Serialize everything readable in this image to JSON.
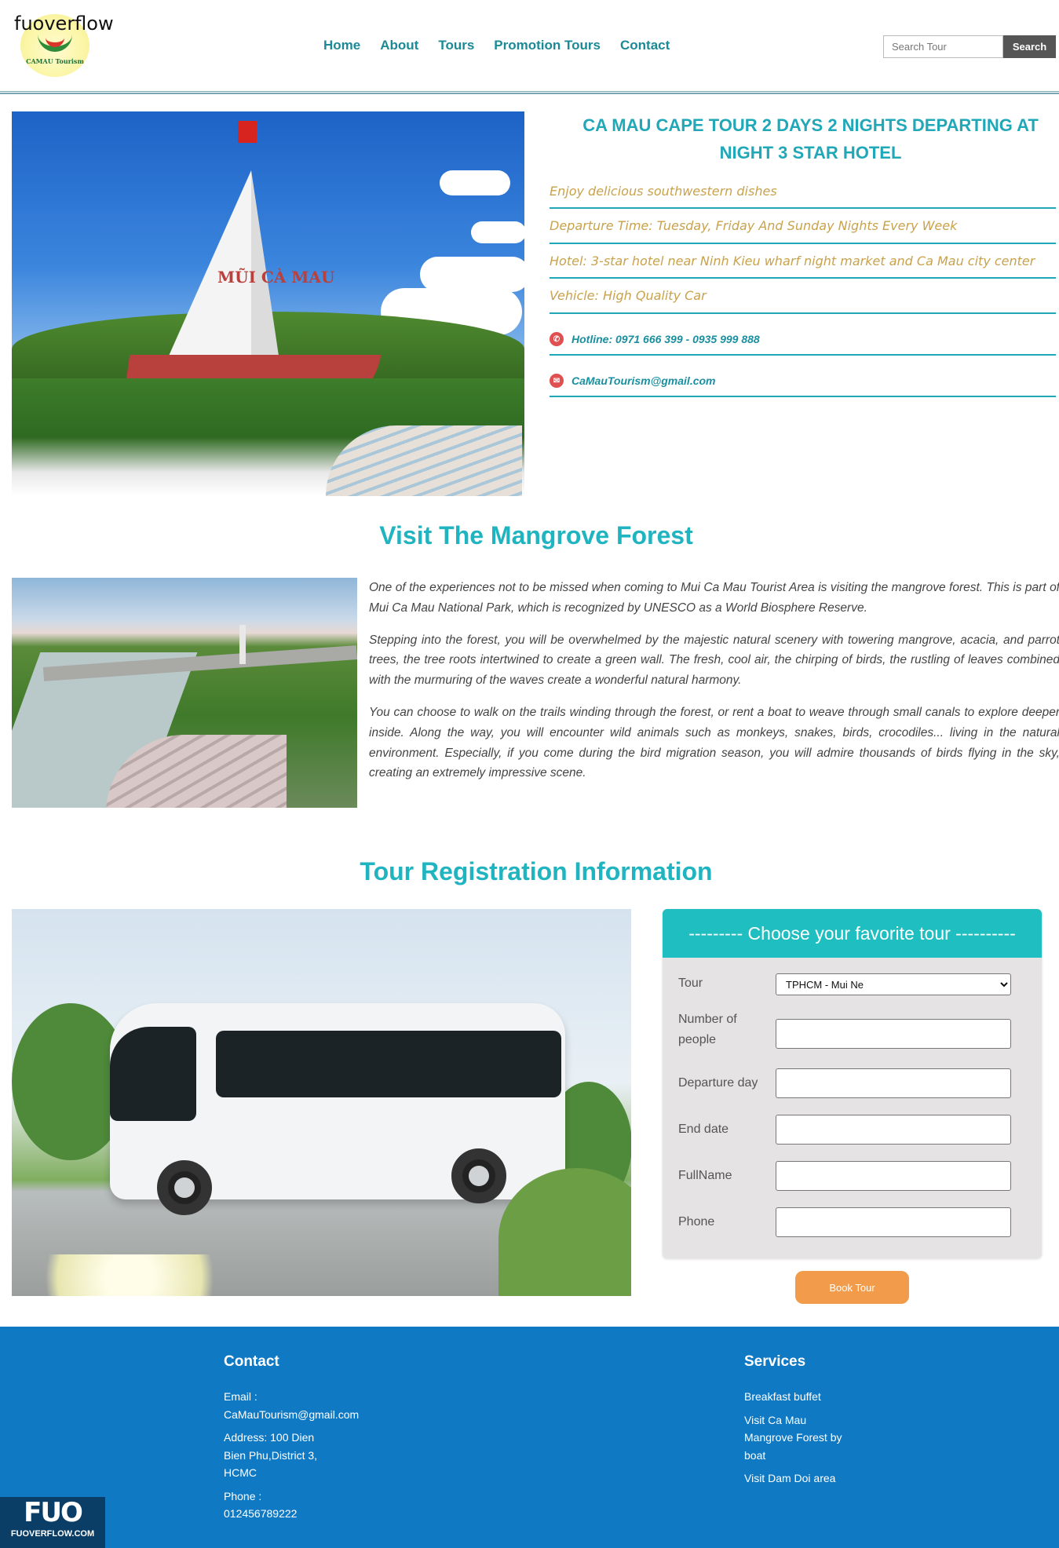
{
  "header": {
    "watermark": "fuoverflow",
    "logo_text": "CAMAU Tourism",
    "nav": [
      "Home",
      "About",
      "Tours",
      "Promotion Tours",
      "Contact"
    ],
    "search_placeholder": "Search Tour",
    "search_button": "Search"
  },
  "hero": {
    "title": "CA MAU CAPE TOUR 2 DAYS 2 NIGHTS DEPARTING AT NIGHT 3 STAR HOTEL",
    "image_sign": "MŨI CÀ MAU",
    "items": [
      "Enjoy delicious southwestern dishes",
      "Departure Time: Tuesday, Friday And Sunday Nights Every Week",
      "Hotel: 3-star hotel near Ninh Kieu wharf night market and Ca Mau city center",
      "Vehicle: High Quality Car"
    ],
    "hotline": "Hotline: 0971 666 399 - 0935 999 888",
    "email": "CaMauTourism@gmail.com"
  },
  "mangrove": {
    "title": "Visit The Mangrove Forest",
    "paragraphs": [
      "One of the experiences not to be missed when coming to Mui Ca Mau Tourist Area is visiting the mangrove forest. This is part of Mui Ca Mau National Park, which is recognized by UNESCO as a World Biosphere Reserve.",
      "Stepping into the forest, you will be overwhelmed by the majestic natural scenery with towering mangrove, acacia, and parrot trees, the tree roots intertwined to create a green wall. The fresh, cool air, the chirping of birds, the rustling of leaves combined with the murmuring of the waves create a wonderful natural harmony.",
      "You can choose to walk on the trails winding through the forest, or rent a boat to weave through small canals to explore deeper inside. Along the way, you will encounter wild animals such as monkeys, snakes, birds, crocodiles... living in the natural environment. Especially, if you come during the bird migration season, you will admire thousands of birds flying in the sky, creating an extremely impressive scene."
    ]
  },
  "registration": {
    "title": "Tour Registration Information",
    "form_title": "--------- Choose your favorite tour ----------",
    "tour_label": "Tour",
    "tour_selected": "TPHCM - Mui Ne",
    "people_label": "Number of people",
    "departure_label": "Departure day",
    "end_label": "End date",
    "fullname_label": "FullName",
    "phone_label": "Phone",
    "book_button": "Book Tour"
  },
  "footer": {
    "contact_title": "Contact",
    "email_label": "Email :",
    "email_value": "CaMauTourism@gmail.com",
    "address": "Address: 100 Dien Bien Phu,District 3, HCMC",
    "phone_label": "Phone :",
    "phone_value": "012456789222",
    "services_title": "Services",
    "services": [
      "Breakfast buffet",
      "Visit Ca Mau Mangrove Forest by boat",
      "Visit Dam Doi area"
    ],
    "badge_big": "FUO",
    "badge_small": "FUOVERFLOW.COM"
  }
}
